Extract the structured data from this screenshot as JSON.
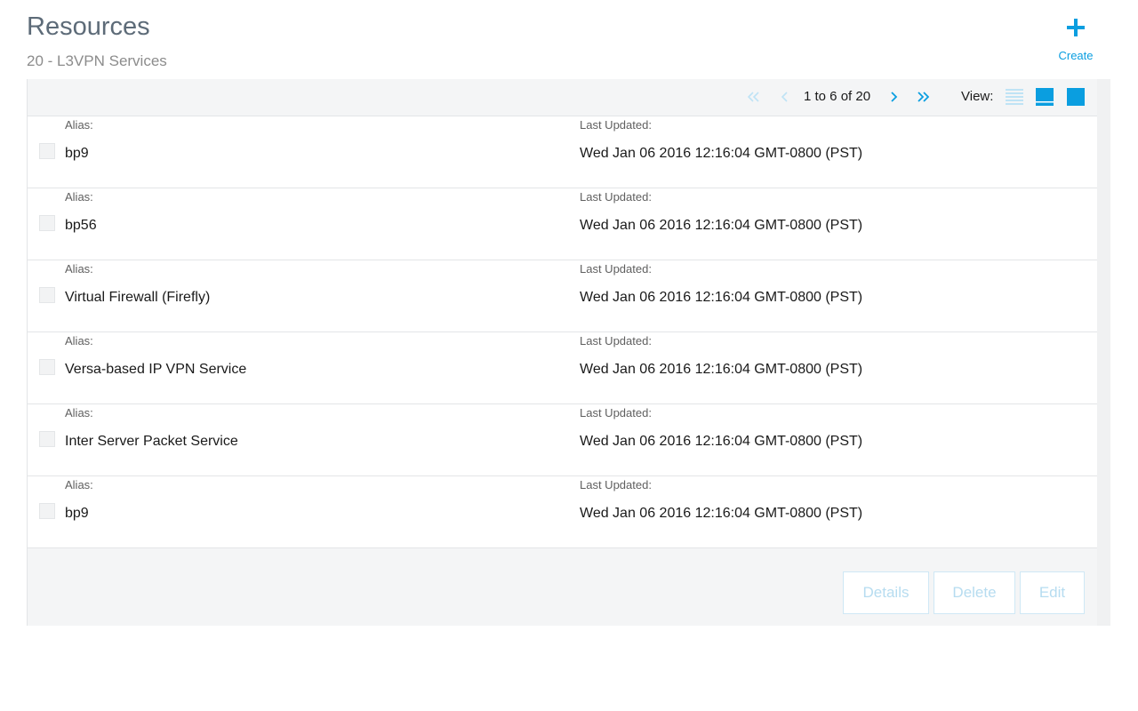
{
  "header": {
    "title": "Resources",
    "subtitle": "20 - L3VPN Services",
    "create_label": "Create"
  },
  "pagination": {
    "text": "1 to 6 of 20",
    "view_label": "View:"
  },
  "list": {
    "alias_label": "Alias:",
    "updated_label": "Last Updated:",
    "rows": [
      {
        "alias": "bp9",
        "updated": "Wed Jan 06 2016 12:16:04 GMT-0800 (PST)"
      },
      {
        "alias": "bp56",
        "updated": "Wed Jan 06 2016 12:16:04 GMT-0800 (PST)"
      },
      {
        "alias": "Virtual Firewall (Firefly)",
        "updated": "Wed Jan 06 2016 12:16:04 GMT-0800 (PST)"
      },
      {
        "alias": "Versa-based IP VPN Service",
        "updated": "Wed Jan 06 2016 12:16:04 GMT-0800 (PST)"
      },
      {
        "alias": "Inter Server Packet Service",
        "updated": "Wed Jan 06 2016 12:16:04 GMT-0800 (PST)"
      },
      {
        "alias": "bp9",
        "updated": "Wed Jan 06 2016 12:16:04 GMT-0800 (PST)"
      }
    ]
  },
  "actions": {
    "details": "Details",
    "delete": "Delete",
    "edit": "Edit"
  },
  "colors": {
    "accent": "#0a9ee0",
    "disabled": "#b6dcf0"
  }
}
